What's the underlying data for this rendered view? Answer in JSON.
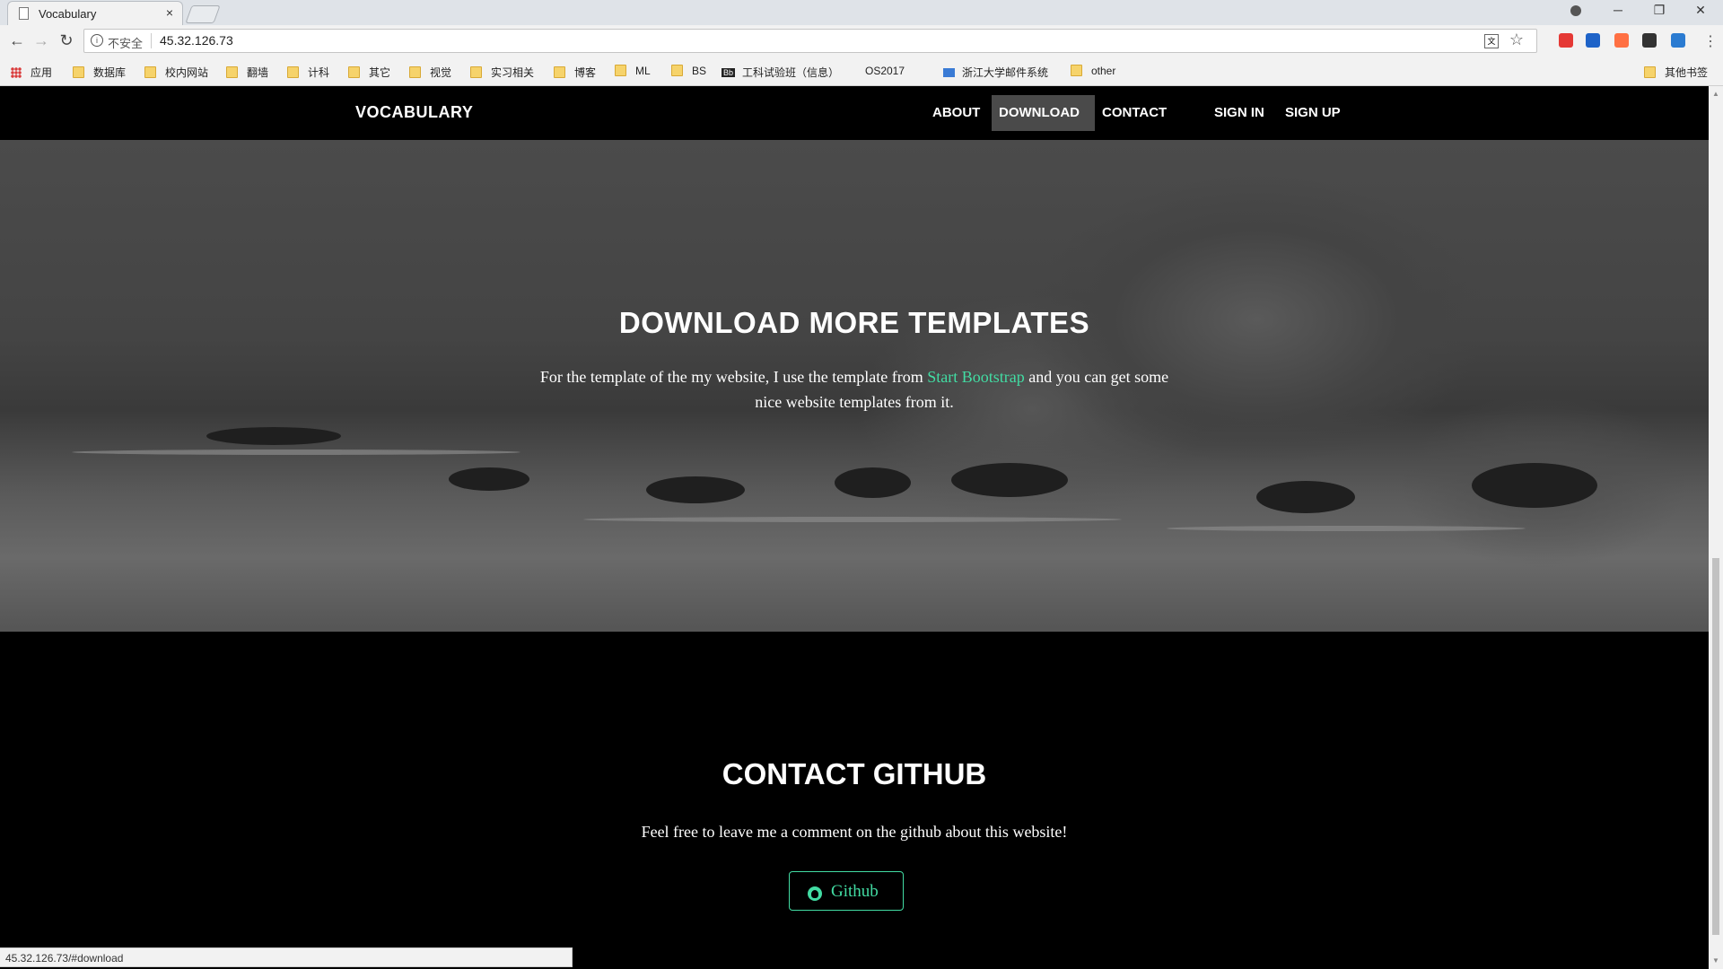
{
  "browser": {
    "tab_title": "Vocabulary",
    "tab_close": "×",
    "window_controls": {
      "minimize": "─",
      "maximize": "❐",
      "close": "✕"
    },
    "insecure_label": "不安全",
    "url": "45.32.126.73",
    "bookmarks": [
      {
        "label": "应用",
        "type": "apps"
      },
      {
        "label": "数据库",
        "type": "folder"
      },
      {
        "label": "校内网站",
        "type": "folder"
      },
      {
        "label": "翻墙",
        "type": "folder"
      },
      {
        "label": "计科",
        "type": "folder"
      },
      {
        "label": "其它",
        "type": "folder"
      },
      {
        "label": "视觉",
        "type": "folder"
      },
      {
        "label": "实习相关",
        "type": "folder"
      },
      {
        "label": "博客",
        "type": "folder"
      },
      {
        "label": "ML",
        "type": "folder"
      },
      {
        "label": "BS",
        "type": "folder"
      },
      {
        "label": "工科试验班（信息）",
        "type": "bb"
      },
      {
        "label": "OS2017",
        "type": "page"
      },
      {
        "label": "浙江大学邮件系统",
        "type": "mail"
      },
      {
        "label": "other",
        "type": "folder"
      }
    ],
    "other_bookmarks": "其他书签",
    "status_url": "45.32.126.73/#download",
    "extension_colors": [
      "#e53935",
      "#1e63c8",
      "#ff7043",
      "#333333",
      "#2b7bd1"
    ]
  },
  "site": {
    "brand": "VOCABULARY",
    "nav": {
      "about": "ABOUT",
      "download": "DOWNLOAD",
      "contact": "CONTACT",
      "sign_in": "SIGN IN",
      "sign_up": "SIGN UP",
      "active": "DOWNLOAD"
    },
    "download": {
      "title": "DOWNLOAD MORE TEMPLATES",
      "text_before": "For the template of the my website, I use the template from ",
      "link": "Start Bootstrap",
      "text_after": " and you can get some nice website templates from it."
    },
    "contact": {
      "title": "CONTACT GITHUB",
      "text": "Feel free to leave me a comment on the github about this website!",
      "button": "Github"
    },
    "accent_color": "#42dca3"
  }
}
